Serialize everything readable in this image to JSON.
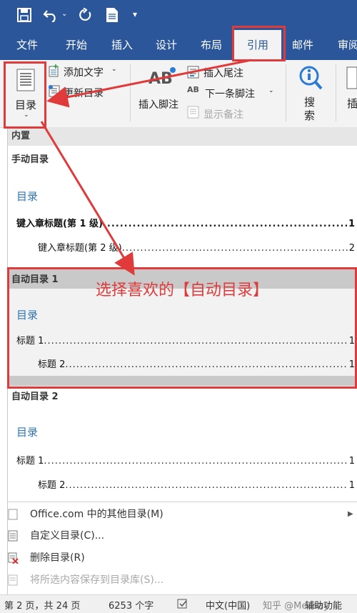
{
  "qat": {
    "icons": [
      "save-icon",
      "undo-icon",
      "redo-icon",
      "new-doc-icon",
      "customize-icon"
    ]
  },
  "tabs": [
    {
      "label": "文件"
    },
    {
      "label": "开始"
    },
    {
      "label": "插入"
    },
    {
      "label": "设计"
    },
    {
      "label": "布局"
    },
    {
      "label": "引用",
      "active": true
    },
    {
      "label": "邮件"
    },
    {
      "label": "审阅"
    }
  ],
  "ribbon": {
    "toc_label": "目录",
    "add_text": "添加文字",
    "update_toc": "更新目录",
    "insert_footnote": "插入脚注",
    "insert_endnote": "插入尾注",
    "next_footnote": "下一条脚注",
    "show_notes": "显示备注",
    "search": "搜索",
    "insert_cut": "插",
    "ab": "AB",
    "ab_small": "AB"
  },
  "gallery": {
    "builtin": "内置",
    "manual": {
      "title": "手动目录",
      "heading": "目录",
      "line1": {
        "text": "键入章标题(第 1 级)",
        "num": "1"
      },
      "line2": {
        "text": "键入章标题(第 2 级)",
        "num": "2"
      }
    },
    "auto1": {
      "title": "自动目录 1",
      "heading": "目录",
      "line1": {
        "text": "标题 1",
        "num": "1"
      },
      "line2": {
        "text": "标题 2",
        "num": "1"
      }
    },
    "auto2": {
      "title": "自动目录 2",
      "heading": "目录",
      "line1": {
        "text": "标题 1",
        "num": "1"
      },
      "line2": {
        "text": "标题 2",
        "num": "1"
      }
    },
    "menu": {
      "more": "Office.com 中的其他目录(M)",
      "custom": "自定义目录(C)...",
      "remove": "删除目录(R)",
      "save": "将所选内容保存到目录库(S)..."
    }
  },
  "annotation": {
    "text": "选择喜欢的【自动目录】",
    "color": "#e03a3a"
  },
  "status": {
    "page": "第 2 页，共 24 页",
    "words": "6253 个字",
    "lang": "中文(中国)",
    "watermark": "知乎 @Measay",
    "accessibility": "辅助功能"
  },
  "dots": "................................................................................................................................................................"
}
